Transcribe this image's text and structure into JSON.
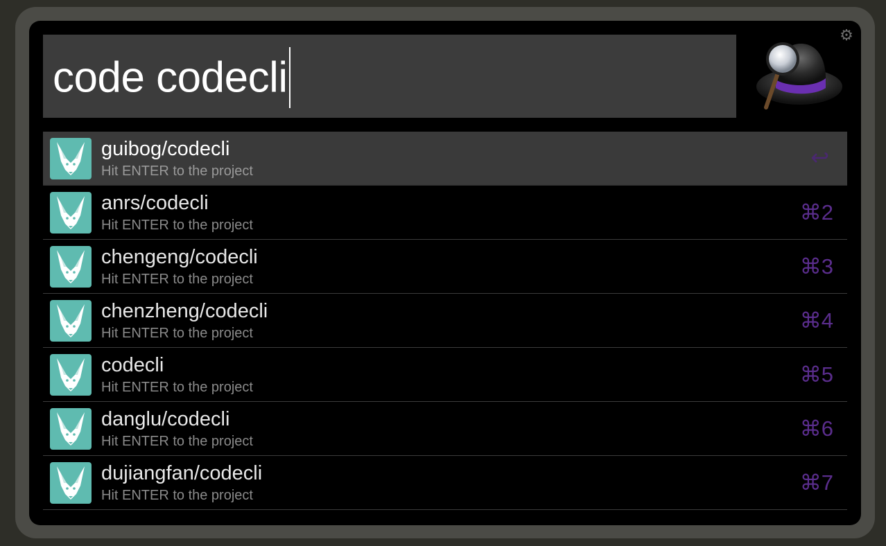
{
  "search": {
    "query": "code codecli"
  },
  "icons": {
    "settings": "gear-icon",
    "app_logo": "alfred-hat-logo",
    "result_icon": "fox-head-icon",
    "enter": "return-arrow-icon"
  },
  "colors": {
    "accent": "#5a2d8c",
    "icon_bg": "#5fbbb0",
    "selected_row": "#3a3a3a"
  },
  "results": [
    {
      "title": "guibog/codecli",
      "subtitle": "Hit ENTER to the project",
      "shortcut": "↩",
      "selected": true
    },
    {
      "title": "anrs/codecli",
      "subtitle": "Hit ENTER to the project",
      "shortcut": "⌘2",
      "selected": false
    },
    {
      "title": "chengeng/codecli",
      "subtitle": "Hit ENTER to the project",
      "shortcut": "⌘3",
      "selected": false
    },
    {
      "title": "chenzheng/codecli",
      "subtitle": "Hit ENTER to the project",
      "shortcut": "⌘4",
      "selected": false
    },
    {
      "title": "codecli",
      "subtitle": "Hit ENTER to the project",
      "shortcut": "⌘5",
      "selected": false
    },
    {
      "title": "danglu/codecli",
      "subtitle": "Hit ENTER to the project",
      "shortcut": "⌘6",
      "selected": false
    },
    {
      "title": "dujiangfan/codecli",
      "subtitle": "Hit ENTER to the project",
      "shortcut": "⌘7",
      "selected": false
    }
  ]
}
